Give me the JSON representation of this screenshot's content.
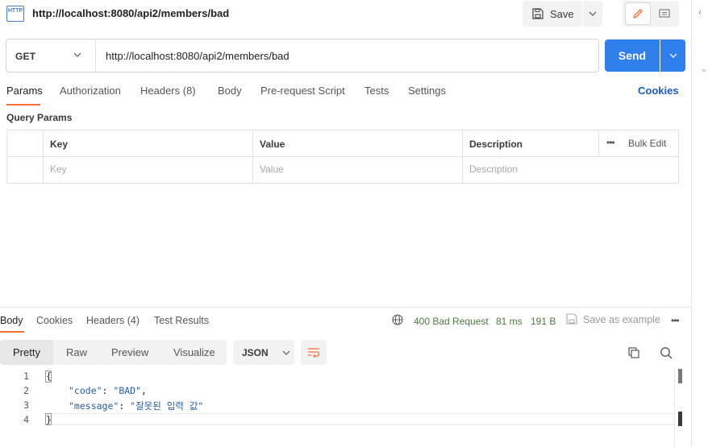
{
  "title_bar": {
    "icon_label": "HTTP",
    "request_name": "http://localhost:8080/api2/members/bad",
    "save_label": "Save"
  },
  "request": {
    "method": "GET",
    "url": "http://localhost:8080/api2/members/bad",
    "send_label": "Send"
  },
  "request_tabs": {
    "params": "Params",
    "authorization": "Authorization",
    "headers": "Headers (8)",
    "body": "Body",
    "prerequest": "Pre-request Script",
    "tests": "Tests",
    "settings": "Settings",
    "cookies": "Cookies",
    "active": "Params"
  },
  "query_params": {
    "title": "Query Params",
    "columns": [
      "Key",
      "Value",
      "Description"
    ],
    "bulk_edit": "Bulk Edit",
    "placeholders": {
      "key": "Key",
      "value": "Value",
      "description": "Description"
    }
  },
  "response_tabs": {
    "body": "Body",
    "cookies": "Cookies",
    "headers": "Headers (4)",
    "test_results": "Test Results",
    "active": "Body"
  },
  "response_meta": {
    "status": "400 Bad Request",
    "time": "81 ms",
    "size": "191 B",
    "save_example": "Save as example",
    "status_color": "#4a7a3e"
  },
  "response_view": {
    "modes": [
      "Pretty",
      "Raw",
      "Preview",
      "Visualize"
    ],
    "active_mode": "Pretty",
    "format": "JSON"
  },
  "response_body": {
    "line_numbers": [
      "1",
      "2",
      "3",
      "4"
    ],
    "line1": "{",
    "line2_key": "\"code\"",
    "line2_value": "\"BAD\"",
    "line3_key": "\"message\"",
    "line3_value": "\"잘못된 입력 값\"",
    "line4": "}"
  },
  "colors": {
    "accent": "#ff6c37",
    "send_button": "#2f80ed",
    "link": "#1a5ac8"
  },
  "icons": [
    "http-icon",
    "save-icon",
    "chevron-down-icon",
    "pencil-icon",
    "comment-icon",
    "globe-icon",
    "save-example-icon",
    "wrap-lines-icon",
    "copy-icon",
    "search-icon",
    "more-icon"
  ]
}
